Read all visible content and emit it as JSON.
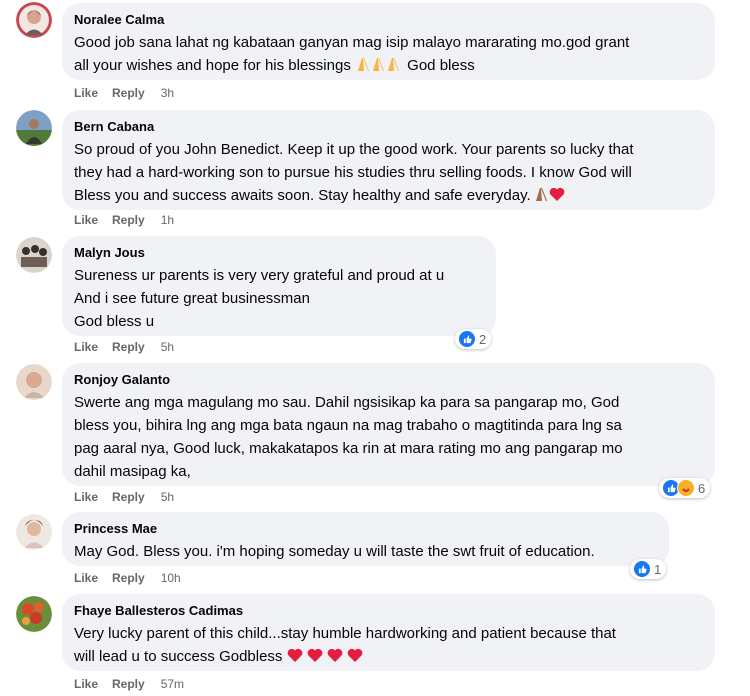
{
  "comments": [
    {
      "author": "Noralee Calma",
      "lines": [
        "Good job sana lahat ng kabataan ganyan mag isip malayo mararating mo.god grant",
        "all your wishes and hope for his blessings",
        "God bless"
      ],
      "emoji_hands": 3,
      "like": "Like",
      "reply": "Reply",
      "time": "3h"
    },
    {
      "author": "Bern Cabana",
      "lines": [
        "So proud of you John Benedict. Keep it up the good work. Your parents so lucky that",
        "they had a hard-working son to pursue his studies thru selling foods. I know God will",
        "Bless you and success awaits soon. Stay healthy and safe everyday."
      ],
      "like": "Like",
      "reply": "Reply",
      "time": "1h"
    },
    {
      "author": "Malyn Jous",
      "lines": [
        "Sureness ur parents is very very grateful and proud at u",
        "And i see future great businessman",
        "God bless u"
      ],
      "like": "Like",
      "reply": "Reply",
      "time": "5h",
      "reaction_count": "2"
    },
    {
      "author": "Ronjoy Galanto",
      "lines": [
        "Swerte ang mga magulang mo sau. Dahil ngsisikap ka para sa pangarap mo, God",
        "bless you, bihira lng ang mga bata ngaun na mag trabaho o magtitinda para lng sa",
        "pag aaral nya, Good luck, makakatapos ka rin at mara rating mo ang pangarap mo",
        "dahil masipag ka,"
      ],
      "like": "Like",
      "reply": "Reply",
      "time": "5h",
      "reaction_count": "6"
    },
    {
      "author": "Princess Mae",
      "lines": [
        "May God. Bless you. i'm hoping someday u will taste the swt fruit of education."
      ],
      "like": "Like",
      "reply": "Reply",
      "time": "10h",
      "reaction_count": "1"
    },
    {
      "author": "Fhaye Ballesteros Cadimas",
      "lines": [
        "Very lucky parent of this child...stay humble hardworking and patient because that",
        "will lead u to success Godbless"
      ],
      "like": "Like",
      "reply": "Reply",
      "time": "57m"
    }
  ],
  "colors": {
    "bubble": "#f0f2f5",
    "like_blue": "#1877f2",
    "meta_gray": "#65676b",
    "heart_red": "#e41e3f"
  }
}
